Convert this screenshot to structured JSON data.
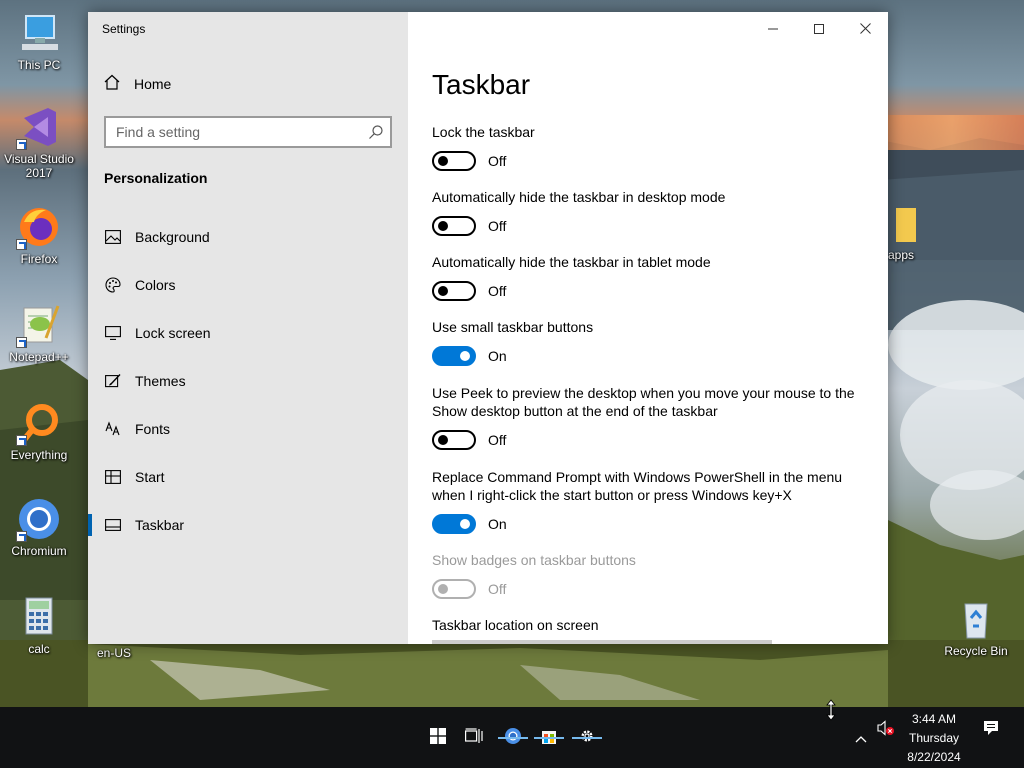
{
  "desktop": {
    "icons": [
      {
        "label": "This PC",
        "name": "this-pc"
      },
      {
        "label": "Visual Studio 2017",
        "name": "visual-studio"
      },
      {
        "label": "Firefox",
        "name": "firefox"
      },
      {
        "label": "Notepad++",
        "name": "notepad-plus-plus"
      },
      {
        "label": "Everything",
        "name": "everything"
      },
      {
        "label": "Chromium",
        "name": "chromium"
      },
      {
        "label": "calc",
        "name": "calc"
      },
      {
        "label": "en-US",
        "name": "en-us-folder"
      },
      {
        "label": "apps",
        "name": "apps-folder"
      },
      {
        "label": "Recycle Bin",
        "name": "recycle-bin"
      }
    ]
  },
  "window": {
    "title": "Settings",
    "controls": {
      "minimize": "minimize-icon",
      "maximize": "maximize-icon",
      "close": "close-icon"
    }
  },
  "sidebar": {
    "home_label": "Home",
    "search_placeholder": "Find a setting",
    "section_title": "Personalization",
    "items": [
      {
        "label": "Background",
        "icon": "picture-icon"
      },
      {
        "label": "Colors",
        "icon": "palette-icon"
      },
      {
        "label": "Lock screen",
        "icon": "monitor-icon"
      },
      {
        "label": "Themes",
        "icon": "brush-icon"
      },
      {
        "label": "Fonts",
        "icon": "font-icon"
      },
      {
        "label": "Start",
        "icon": "start-grid-icon"
      },
      {
        "label": "Taskbar",
        "icon": "taskbar-icon",
        "active": true
      }
    ]
  },
  "main": {
    "title": "Taskbar",
    "settings": [
      {
        "label": "Lock the taskbar",
        "state": "Off",
        "on": false,
        "enabled": true
      },
      {
        "label": "Automatically hide the taskbar in desktop mode",
        "state": "Off",
        "on": false,
        "enabled": true
      },
      {
        "label": "Automatically hide the taskbar in tablet mode",
        "state": "Off",
        "on": false,
        "enabled": true
      },
      {
        "label": "Use small taskbar buttons",
        "state": "On",
        "on": true,
        "enabled": true
      },
      {
        "label": "Use Peek to preview the desktop when you move your mouse to the Show desktop button at the end of the taskbar",
        "state": "Off",
        "on": false,
        "enabled": true
      },
      {
        "label": "Replace Command Prompt with Windows PowerShell in the menu when I right-click the start button or press Windows key+X",
        "state": "On",
        "on": true,
        "enabled": true
      },
      {
        "label": "Show badges on taskbar buttons",
        "state": "Off",
        "on": false,
        "enabled": false
      }
    ],
    "location_label": "Taskbar location on screen"
  },
  "taskbar": {
    "time": "3:44 AM",
    "day": "Thursday",
    "date": "8/22/2024",
    "accent": "#76b9ed"
  },
  "colors": {
    "accent": "#0078d7",
    "sidebar_bg": "#e6e6e6",
    "taskbar_bg": "#111214"
  }
}
